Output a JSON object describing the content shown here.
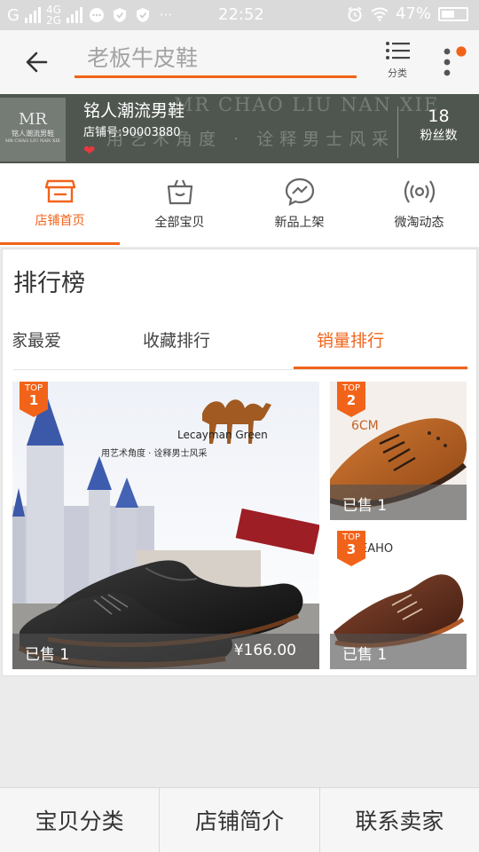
{
  "status_bar": {
    "carrier_letter": "G",
    "net_top": "4G",
    "net_bottom": "2G",
    "time": "22:52",
    "battery": "47%"
  },
  "top_nav": {
    "search_placeholder": "老板牛皮鞋",
    "category_label": "分类",
    "accent": "#f2631a"
  },
  "shop": {
    "logo_mark": "MR",
    "logo_text": "铭人潮流男鞋",
    "logo_sub": "MR CHAO LIU NAN XIE",
    "banner_pinyin": "MR CHAO LIU NAN XIE",
    "banner_slogan": "用艺术角度 · 诠释男士风采",
    "name": "铭人潮流男鞋",
    "number_label": "店铺号:90003880",
    "fans_count": "18",
    "fans_label": "粉丝数"
  },
  "shop_tabs": [
    {
      "label": "店铺首页",
      "icon": "store-icon",
      "active": true
    },
    {
      "label": "全部宝贝",
      "icon": "shopping-bag-icon",
      "active": false
    },
    {
      "label": "新品上架",
      "icon": "chat-lightning-icon",
      "active": false
    },
    {
      "label": "微淘动态",
      "icon": "broadcast-icon",
      "active": false
    }
  ],
  "ranking": {
    "title": "排行榜",
    "tabs": [
      {
        "label": "买家最爱",
        "active": false
      },
      {
        "label": "收藏排行",
        "active": false
      },
      {
        "label": "销量排行",
        "active": true
      }
    ],
    "products": [
      {
        "rank_badge": "TOP",
        "rank": "1",
        "sold": "已售 1",
        "price": "¥166.00",
        "brand": "Lecayman Green",
        "slogan": "用艺术角度 · 诠释男士风采"
      },
      {
        "rank_badge": "TOP",
        "rank": "2",
        "sold": "已售 1",
        "note": "6CM"
      },
      {
        "rank_badge": "TOP",
        "rank": "3",
        "sold": "已售 1",
        "brand": "EAHO"
      }
    ]
  },
  "bottom_bar": {
    "category": "宝贝分类",
    "intro": "店铺简介",
    "contact": "联系卖家"
  }
}
